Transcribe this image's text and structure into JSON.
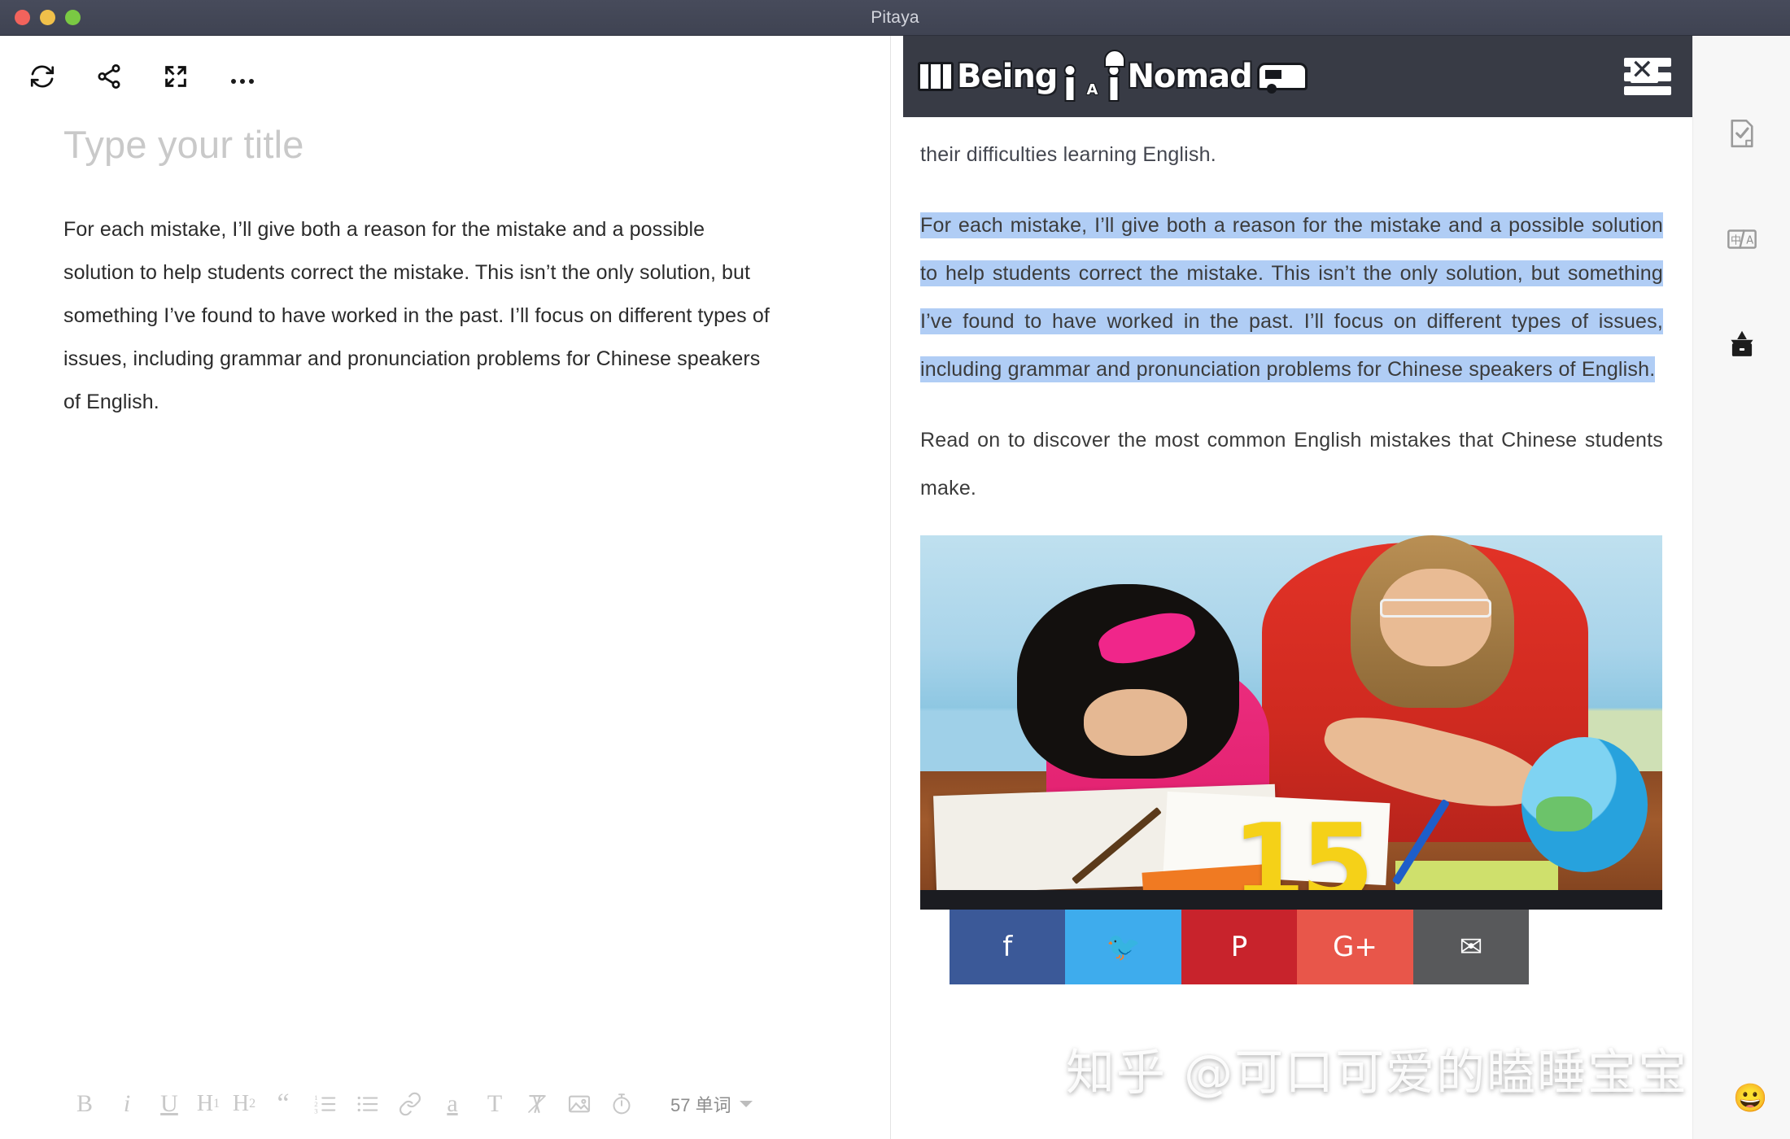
{
  "window": {
    "title": "Pitaya",
    "traffic_lights": [
      "close",
      "minimize",
      "maximize"
    ]
  },
  "editor": {
    "toolbar": [
      {
        "name": "sync-icon",
        "label": "Sync"
      },
      {
        "name": "share-icon",
        "label": "Share"
      },
      {
        "name": "fullscreen-icon",
        "label": "Fullscreen"
      },
      {
        "name": "more-icon",
        "label": "More"
      }
    ],
    "title_placeholder": "Type your title",
    "paragraph": "For each mistake, I’ll give both a reason for the mistake and a possible solution to help students correct the mistake. This isn’t the only solution, but something I’ve found to have worked in the past. I’ll focus on different types of issues, including grammar and pronunciation problems for Chinese speakers of English."
  },
  "format_bar": {
    "items": [
      {
        "name": "bold-button",
        "label": "B"
      },
      {
        "name": "italic-button",
        "label": "i"
      },
      {
        "name": "underline-button",
        "label": "U"
      },
      {
        "name": "heading1-button",
        "label": "H",
        "sub": "1"
      },
      {
        "name": "heading2-button",
        "label": "H",
        "sub": "2"
      },
      {
        "name": "blockquote-button",
        "label": "“"
      },
      {
        "name": "ordered-list-button",
        "label": "ol-icon"
      },
      {
        "name": "bullet-list-button",
        "label": "ul-icon"
      },
      {
        "name": "link-button",
        "label": "link-icon"
      },
      {
        "name": "highlight-button",
        "label": "a"
      },
      {
        "name": "text-style-button",
        "label": "T"
      },
      {
        "name": "clear-format-button",
        "label": "clear-format-icon"
      },
      {
        "name": "insert-image-button",
        "label": "image-icon"
      },
      {
        "name": "timer-button",
        "label": "timer-icon"
      }
    ],
    "word_count": "57 单词"
  },
  "preview": {
    "site_logo": {
      "text_one": "Being",
      "text_a": "A",
      "text_two": "Nomad",
      "icons": [
        "passport-icon",
        "people-icon",
        "umbrella-icon",
        "caravan-icon"
      ]
    },
    "menu_icon": "hamburger-menu-icon",
    "close_icon": "close-x-icon",
    "paragraphs": [
      {
        "id": "p-intro",
        "selected": false,
        "text": "…to Chinese students. But students can use it as well to help them overcome their difficulties learning English."
      },
      {
        "id": "p-selected",
        "selected": true,
        "text": "For each mistake, I’ll give both a reason for the mistake and a possible solution to help students correct the mistake. This isn’t the only solution, but something I’ve found to have worked in the past. I’ll focus on different types of issues, including grammar and pronunciation problems for Chinese speakers of English."
      },
      {
        "id": "p-readon",
        "selected": false,
        "text": "Read on to discover the most common English mistakes that Chinese students make."
      }
    ],
    "photo": {
      "name": "teacher-tutoring-student-photo",
      "overlay_number": "15"
    },
    "share_buttons": [
      {
        "name": "facebook-share-button",
        "glyph": "f",
        "color": "#3b5998"
      },
      {
        "name": "twitter-share-button",
        "glyph": "🐦",
        "color": "#3eaced"
      },
      {
        "name": "pinterest-share-button",
        "glyph": "P",
        "color": "#c8232c"
      },
      {
        "name": "googleplus-share-button",
        "glyph": "G+",
        "color": "#e8564a"
      },
      {
        "name": "email-share-button",
        "glyph": "✉",
        "color": "#58595b"
      }
    ]
  },
  "watermark": {
    "text": "知乎 @可口可爱的瞌睡宝宝",
    "emoji": "😀"
  },
  "right_rail": [
    {
      "name": "document-check-icon",
      "label": "Proofread"
    },
    {
      "name": "translate-icon",
      "label": "中/A"
    },
    {
      "name": "archive-box-icon",
      "label": "Archive"
    }
  ],
  "colors": {
    "titlebar": "#3f4352",
    "selection": "#b0cdf5",
    "site_header": "#383b45",
    "rail_bg": "#f7f7f7"
  }
}
